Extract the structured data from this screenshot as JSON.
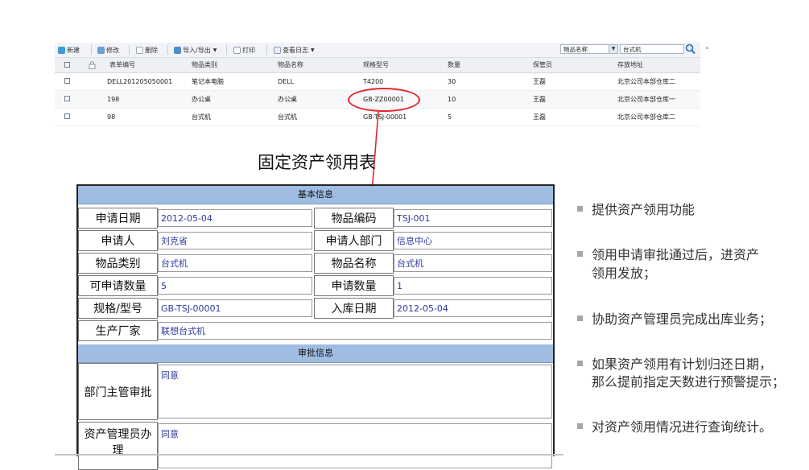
{
  "toolbar": {
    "new": "新建",
    "edit": "修改",
    "delete": "删除",
    "import_export": "导入/导出",
    "print": "打印",
    "view_log": "查看日志",
    "filter_field": "物品名称",
    "search_value": "台式机"
  },
  "grid": {
    "columns": [
      "表单编号",
      "物品类别",
      "物品名称",
      "规格型号",
      "数量",
      "保管员",
      "存放地址"
    ],
    "rows": [
      [
        "DELL201205050001",
        "笔记本电脑",
        "DELL",
        "T4200",
        "30",
        "王磊",
        "北京公司本部仓库二"
      ],
      [
        "198",
        "办公桌",
        "办公桌",
        "GB-ZZ00001",
        "10",
        "王磊",
        "北京公司本部仓库一"
      ],
      [
        "98",
        "台式机",
        "台式机",
        "GB-TSJ-00001",
        "5",
        "王磊",
        "北京公司本部仓库二"
      ]
    ]
  },
  "form": {
    "title": "固定资产领用表",
    "section_basic": "基本信息",
    "section_approval": "审批信息",
    "labels": {
      "apply_date": "申请日期",
      "item_code": "物品编码",
      "applicant": "申请人",
      "applicant_dept": "申请人部门",
      "item_category": "物品类别",
      "item_name": "物品名称",
      "available_qty": "可申请数量",
      "apply_qty": "申请数量",
      "spec": "规格/型号",
      "stock_date": "入库日期",
      "manufacturer": "生产厂家",
      "dept_approval": "部门主管审批",
      "asset_admin": "资产管理员办理"
    },
    "values": {
      "apply_date": "2012-05-04",
      "item_code": "TSJ-001",
      "applicant": "刘克省",
      "applicant_dept": "信息中心",
      "item_category": "台式机",
      "item_name": "台式机",
      "available_qty": "5",
      "apply_qty": "1",
      "spec": "GB-TSJ-00001",
      "stock_date": "2012-05-04",
      "manufacturer": "联想台式机",
      "dept_approval": "同意",
      "asset_admin": "同意"
    }
  },
  "features": [
    [
      "提供资产领用功能"
    ],
    [
      "领用申请审批通过后，进资产",
      "领用发放；"
    ],
    [
      "协助资产管理员完成出库业务；"
    ],
    [
      "如果资产领用有计划归还日期，",
      "那么提前指定天数进行预警提示；"
    ],
    [
      "对资产领用情况进行查询统计。"
    ]
  ],
  "colors": {
    "accent_red": "#e0282d",
    "section_blue": "#9fbde3",
    "value_blue": "#2e3a9e"
  },
  "icons": [
    "new-icon",
    "edit-icon",
    "delete-icon",
    "import-export-icon",
    "print-icon",
    "log-icon",
    "search-icon",
    "lock-icon",
    "expand-icon"
  ]
}
